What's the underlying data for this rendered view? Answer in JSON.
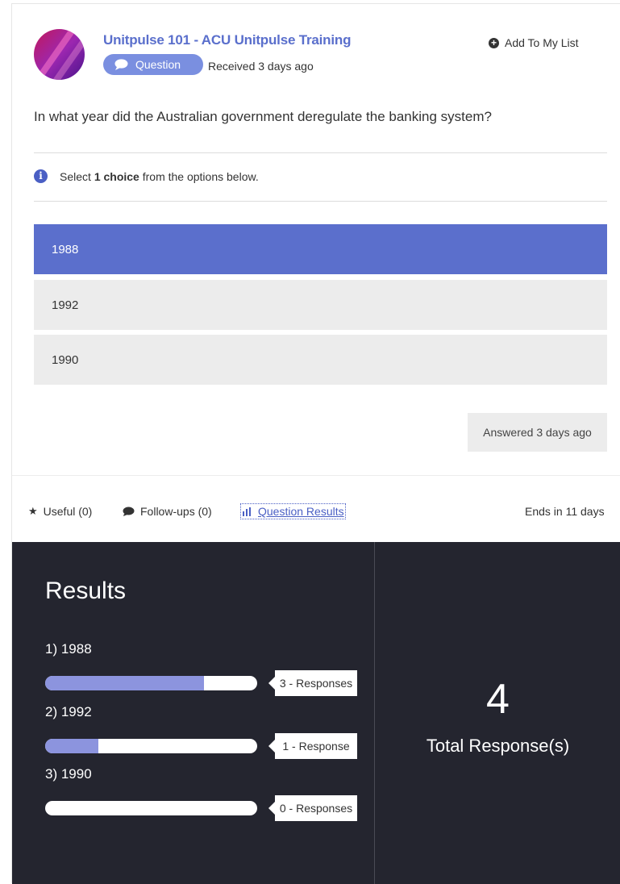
{
  "header": {
    "title": "Unitpulse 101 - ACU Unitpulse Training",
    "badge_label": "Question",
    "received": "Received 3 days ago",
    "add_to_list": "Add To My List"
  },
  "question": {
    "text": "In what year did the Australian government deregulate the banking system?",
    "instruction_prefix": "Select ",
    "instruction_bold": "1 choice",
    "instruction_suffix": " from the options below."
  },
  "choices": [
    {
      "label": "1988",
      "selected": true
    },
    {
      "label": "1992",
      "selected": false
    },
    {
      "label": "1990",
      "selected": false
    }
  ],
  "answered": "Answered 3 days ago",
  "footer": {
    "useful": "Useful (0)",
    "followups": "Follow-ups (0)",
    "question_results": "Question Results",
    "ends": "Ends in 11 days"
  },
  "results": {
    "heading": "Results",
    "options": [
      {
        "label": "1) 1988",
        "responses": 3,
        "fraction": 0.75,
        "tag": "3 - Responses"
      },
      {
        "label": "2) 1992",
        "responses": 1,
        "fraction": 0.25,
        "tag": "1 - Response"
      },
      {
        "label": "3) 1990",
        "responses": 0,
        "fraction": 0.0,
        "tag": "0 - Responses"
      }
    ],
    "total_number": "4",
    "total_label": "Total Response(s)"
  },
  "colors": {
    "accent": "#5b6fcc",
    "badge": "#7a8fe0",
    "panel_bg": "#24252f",
    "bar_fill": "#8c94de"
  },
  "icons": {
    "badge": "speech-bubble-icon",
    "add": "plus-circle-icon",
    "info": "info-icon",
    "useful": "star-icon",
    "followups": "comment-icon",
    "results": "bar-chart-icon"
  }
}
